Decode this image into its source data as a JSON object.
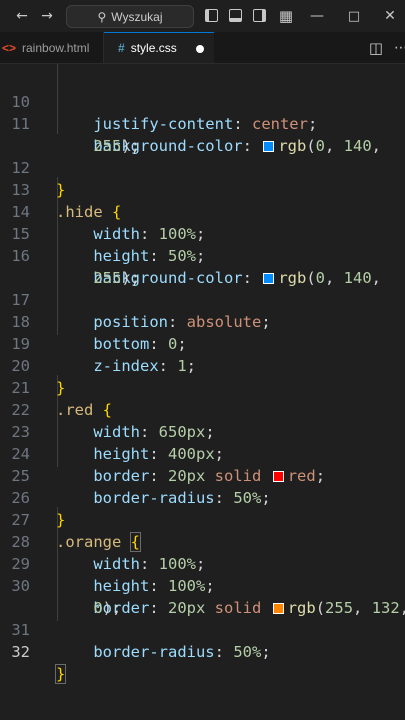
{
  "titlebar": {
    "search_placeholder": "Wyszukaj",
    "icons": [
      "arrow-left-icon",
      "arrow-right-icon",
      "search-icon",
      "layout-sidebar-icon",
      "layout-panel-icon",
      "layout-sidebar-right-icon",
      "layout-grid-icon",
      "minimize-icon",
      "maximize-icon",
      "close-icon"
    ]
  },
  "tabs": [
    {
      "label": "rainbow.html",
      "icon": "html-file-icon",
      "active": false
    },
    {
      "label": "style.css",
      "icon": "css-file-icon",
      "active": true,
      "modified": true
    }
  ],
  "colors": {
    "selector": "#d7ba7d",
    "property": "#9cdcfe",
    "value": "#ce9178",
    "number": "#b5cea8",
    "function": "#dcdcaa",
    "brace": "#ffd700",
    "swatch_blue": "#008cff",
    "swatch_red": "#ff0000",
    "swatch_orange": "#ff8400"
  },
  "editor": {
    "current_line": "32",
    "lines": [
      {
        "n": "",
        "t": "    justify-content: center;"
      },
      {
        "n": "10",
        "t": "    justify-content: center;"
      },
      {
        "n": "11",
        "t": "    background-color: rgb(0, 140,"
      },
      {
        "n": "",
        "t": "    255);"
      },
      {
        "n": "12",
        "t": "}"
      },
      {
        "n": "13",
        "t": ".hide {"
      },
      {
        "n": "14",
        "t": "    width: 100%;"
      },
      {
        "n": "15",
        "t": "    height: 50%;"
      },
      {
        "n": "16",
        "t": "    background-color: rgb(0, 140,"
      },
      {
        "n": "",
        "t": "    255);"
      },
      {
        "n": "17",
        "t": "    position: absolute;"
      },
      {
        "n": "18",
        "t": "    bottom: 0;"
      },
      {
        "n": "19",
        "t": "    z-index: 1;"
      },
      {
        "n": "20",
        "t": "}"
      },
      {
        "n": "21",
        "t": ".red {"
      },
      {
        "n": "22",
        "t": "    width: 650px;"
      },
      {
        "n": "23",
        "t": "    height: 400px;"
      },
      {
        "n": "24",
        "t": "    border: 20px solid red;"
      },
      {
        "n": "25",
        "t": "    border-radius: 50%;"
      },
      {
        "n": "26",
        "t": "}"
      },
      {
        "n": "27",
        "t": ".orange {"
      },
      {
        "n": "28",
        "t": "    width: 100%;"
      },
      {
        "n": "29",
        "t": "    height: 100%;"
      },
      {
        "n": "30",
        "t": "    border: 20px solid rgb(255, 132,"
      },
      {
        "n": "",
        "t": "    0);"
      },
      {
        "n": "31",
        "t": "    border-radius: 50%;"
      },
      {
        "n": "32",
        "t": "}"
      }
    ]
  }
}
